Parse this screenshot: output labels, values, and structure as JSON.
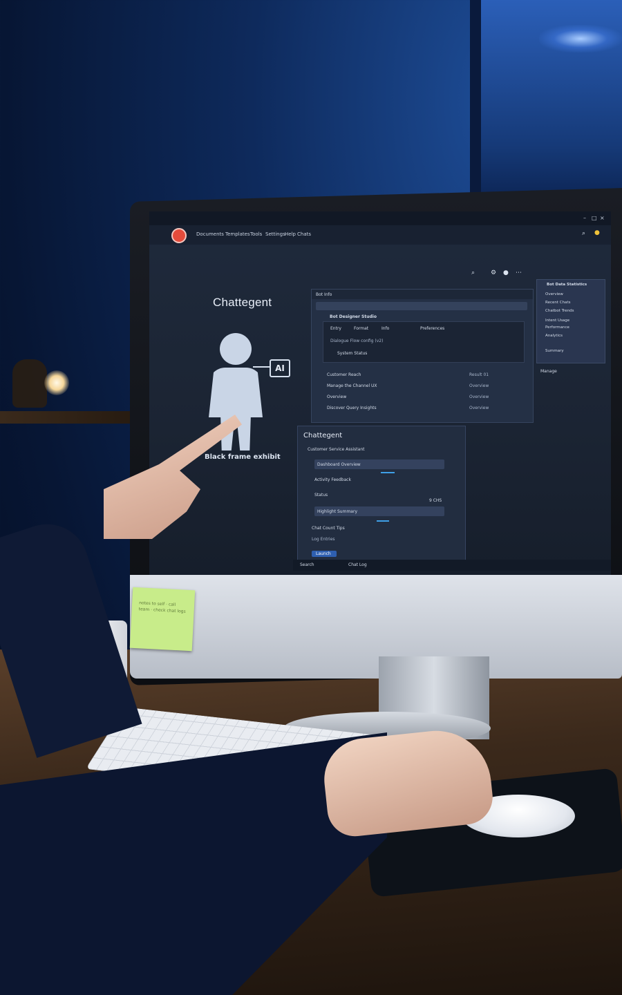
{
  "screen": {
    "menu_items": [
      "Documents",
      "Templates",
      "Tools",
      "Settings",
      "Help",
      "Chats"
    ],
    "brand": "Chattegent",
    "ai_label": "AI",
    "caption": "Black frame exhibit",
    "panel1": {
      "header": "Bot Info",
      "title": "Bot Designer Studio",
      "rows": [
        "Entry",
        "Format",
        "Info",
        "Preferences"
      ],
      "subline": "Dialogue Flow config (v2)",
      "status": "System Status",
      "list": [
        {
          "label": "Customer Reach",
          "value": "Result 01"
        },
        {
          "label": "Manage the Channel UX",
          "value": "Overview"
        },
        {
          "label": "Overview",
          "value": "Overview"
        },
        {
          "label": "Discover Query Insights",
          "value": "Overview"
        }
      ]
    },
    "panel2": {
      "title": "Chattegent",
      "subtitle": "Customer Service Assistant",
      "rows": [
        "Dashboard Overview",
        "Activity Feedback",
        "Status",
        "Highlight Summary",
        "Chat Count Tips",
        "Log Entries"
      ],
      "stat": "9 CHS",
      "button": "Launch"
    },
    "sidebar": {
      "title": "Bot Data Statistics",
      "items": [
        "Overview",
        "Recent Chats",
        "Chatbot Trends",
        "Intent Usage",
        "Performance",
        "Analytics",
        "Summary"
      ],
      "tag": "Manage"
    },
    "bottombar": [
      "Search",
      "Chat Log"
    ]
  },
  "sticky_note": "notes to self · call team · check chat logs"
}
